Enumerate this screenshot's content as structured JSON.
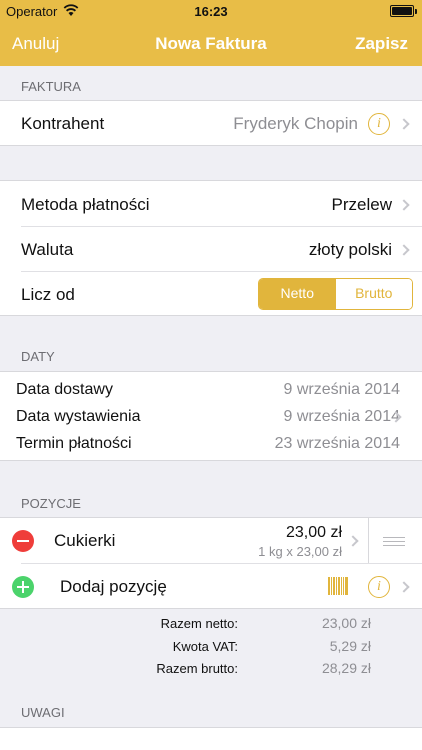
{
  "status_bar": {
    "carrier": "Operator",
    "time": "16:23"
  },
  "nav": {
    "cancel_label": "Anuluj",
    "title": "Nowa Faktura",
    "save_label": "Zapisz"
  },
  "sections": {
    "invoice": "FAKTURA",
    "dates": "DATY",
    "items": "POZYCJE",
    "notes": "UWAGI"
  },
  "invoice": {
    "contractor_label": "Kontrahent",
    "contractor_value": "Fryderyk Chopin"
  },
  "payment": {
    "method_label": "Metoda płatności",
    "method_value": "Przelew",
    "currency_label": "Waluta",
    "currency_value": "złoty polski",
    "calc_label": "Licz od",
    "segments": [
      {
        "label": "Netto",
        "selected": true
      },
      {
        "label": "Brutto",
        "selected": false
      }
    ]
  },
  "dates": [
    {
      "label": "Data dostawy",
      "value": "9 września 2014"
    },
    {
      "label": "Data wystawienia",
      "value": "9 września 2014"
    },
    {
      "label": "Termin płatności",
      "value": "23 września 2014"
    }
  ],
  "items": [
    {
      "name": "Cukierki",
      "total": "23,00 zł",
      "detail": "1 kg x 23,00 zł"
    }
  ],
  "add_item_label": "Dodaj pozycję",
  "totals": [
    {
      "label": "Razem netto:",
      "value": "23,00 zł"
    },
    {
      "label": "Kwota VAT:",
      "value": "5,29 zł"
    },
    {
      "label": "Razem brutto:",
      "value": "28,29 zł"
    }
  ],
  "colors": {
    "accent": "#e1b53c",
    "nav_bar": "#e8bd47",
    "delete": "#ef3d3a",
    "add": "#4bd36b"
  },
  "icons": {
    "info": "i"
  }
}
